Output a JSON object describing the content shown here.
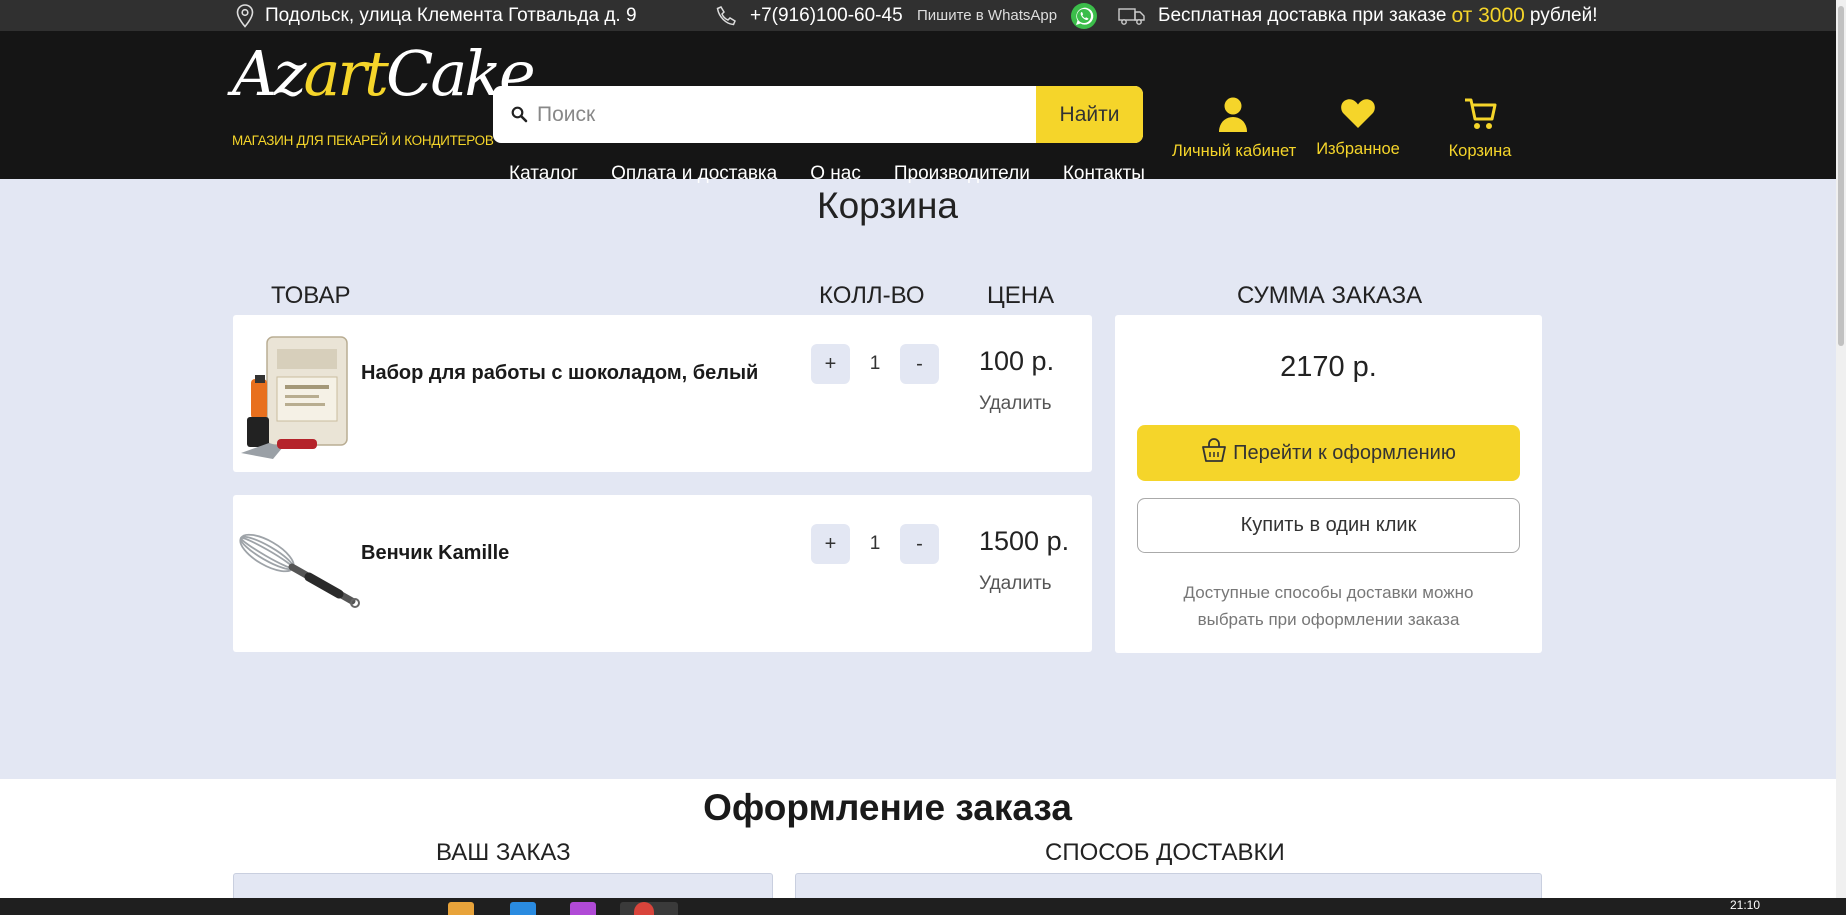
{
  "topbar": {
    "address": "Подольск, улица Клемента Готвальда д. 9",
    "phone": "+7(916)100-60-45",
    "whatsapp_text": "Пишите в WhatsApp",
    "delivery_prefix": "Бесплатная доставка при заказе",
    "delivery_amount": "от 3000",
    "delivery_suffix": "рублей!"
  },
  "logo": {
    "script_a": "Az",
    "script_art": "art",
    "script_b": "Cake",
    "tagline": "МАГАЗИН ДЛЯ ПЕКАРЕЙ И КОНДИТЕРОВ"
  },
  "search": {
    "placeholder": "Поиск",
    "button": "Найти"
  },
  "nav": [
    "Каталог",
    "Оплата и доставка",
    "О нас",
    "Производители",
    "Контакты"
  ],
  "header_icons": {
    "account": "Личный кабинет",
    "favorites": "Избранное",
    "cart": "Корзина"
  },
  "cart": {
    "title": "Корзина",
    "col_product": "ТОВАР",
    "col_qty": "КОЛЛ-ВО",
    "col_price": "ЦЕНА",
    "col_summary": "СУММА ЗАКАЗА",
    "items": [
      {
        "name": "Набор для работы с шоколадом, белый",
        "qty": "1",
        "price": "100 р.",
        "remove": "Удалить",
        "plus": "+",
        "minus": "-"
      },
      {
        "name": "Венчик Kamille",
        "qty": "1",
        "price": "1500 р.",
        "remove": "Удалить",
        "plus": "+",
        "minus": "-"
      }
    ],
    "total": "2170 р.",
    "checkout_button": "Перейти к оформлению",
    "one_click_button": "Купить в один клик",
    "delivery_note_line1": "Доступные способы доставки можно",
    "delivery_note_line2": "выбрать при оформлении заказа"
  },
  "order": {
    "title": "Оформление заказа",
    "your_order": "ВАШ ЗАКАЗ",
    "delivery_method": "СПОСОБ ДОСТАВКИ"
  },
  "taskbar": {
    "time": "21:10"
  },
  "colors": {
    "accent": "#f5d52a",
    "header_bg": "#151515",
    "page_bg": "#e3e7f3"
  }
}
